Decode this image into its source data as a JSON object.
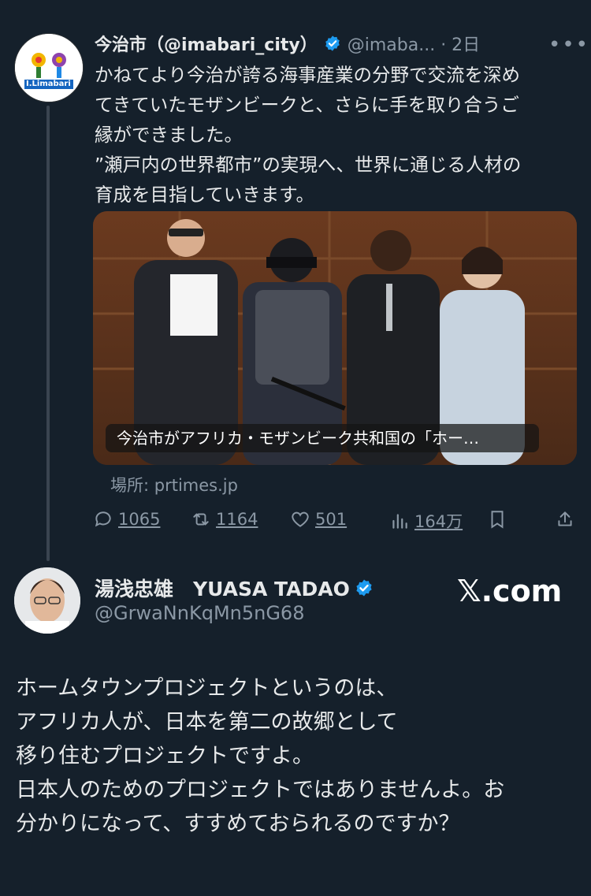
{
  "tweet": {
    "avatar_text": "I.Limabari",
    "author_name": "今治市（@imabari_city）",
    "handle_time": "@imaba... · 2日",
    "body_lines": [
      "かねてより今治が誇る海事産業の分野で交流を深め",
      "てきていたモザンビークと、さらに手を取り合うご",
      "縁ができました。",
      "”瀬戸内の世界都市”の実現へ、世界に通じる人材の",
      "育成を目指していきます。"
    ],
    "card_caption": "今治市がアフリカ・モザンビーク共和国の「ホー…",
    "source": "場所: prtimes.jp",
    "replies": "1065",
    "retweets": "1164",
    "likes": "501",
    "views": "164万"
  },
  "reply": {
    "author_name": "湯浅忠雄　YUASA TADAO",
    "handle": "@GrwaNnKqMn5nG68",
    "brand": "𝕏.com",
    "body_lines": [
      "ホームタウンプロジェクトというのは、",
      "アフリカ人が、日本を第二の故郷として",
      "移り住むプロジェクトですよ。",
      "日本人のためのプロジェクトではありませんよ。お",
      "分かりになって、すすめておられるのですか？"
    ]
  },
  "colors": {
    "background": "#15202b",
    "text": "#e7e9ea",
    "muted": "#8b98a5",
    "verified": "#1d9bf0"
  },
  "icons": [
    "verified-badge-icon",
    "more-icon",
    "reply-icon",
    "retweet-icon",
    "like-icon",
    "views-icon",
    "bookmark-icon",
    "share-icon"
  ]
}
